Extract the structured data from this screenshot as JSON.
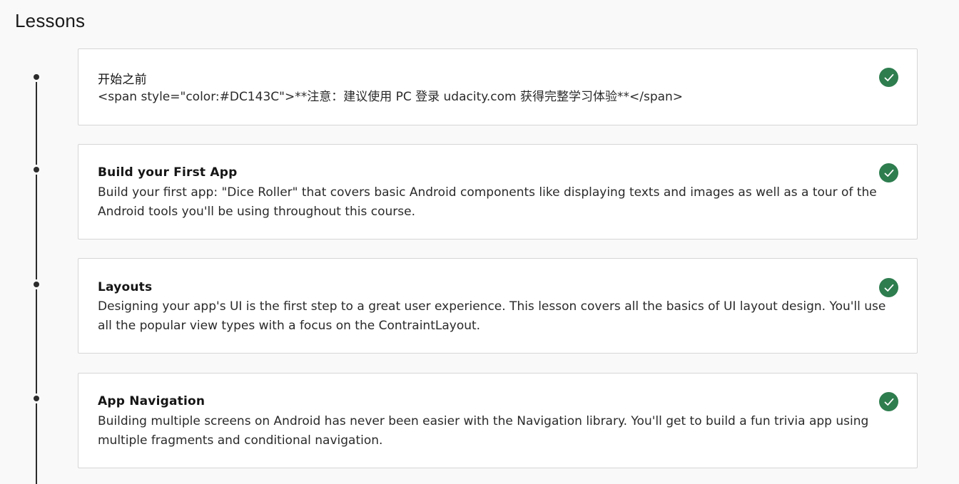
{
  "page": {
    "title": "Lessons"
  },
  "lessons": [
    {
      "title": "开始之前",
      "description": "<span style=\"color:#DC143C\">**注意：建议使用 PC 登录 udacity.com 获得完整学习体验**</span>",
      "completed": true
    },
    {
      "title": "Build your First App",
      "description": "Build your first app: \"Dice Roller\" that covers basic Android components like displaying texts and images as well as a tour of the Android tools you'll be using throughout this course.",
      "completed": true
    },
    {
      "title": "Layouts",
      "description": "Designing your app's UI is the first step to a great user experience. This lesson covers all the basics of UI layout design. You'll use all the popular view types with a focus on the ContraintLayout.",
      "completed": true
    },
    {
      "title": "App Navigation",
      "description": "Building multiple screens on Android has never been easier with the Navigation library. You'll get to build a fun trivia app using multiple fragments and conditional navigation.",
      "completed": true
    }
  ],
  "colors": {
    "check_green": "#2e7d4f",
    "timeline": "#2b2b2b",
    "card_border": "#d6d6d6",
    "background": "#f9f9f9"
  },
  "icons": {
    "completed": "check-circle-icon",
    "timeline_marker": "timeline-dot"
  }
}
